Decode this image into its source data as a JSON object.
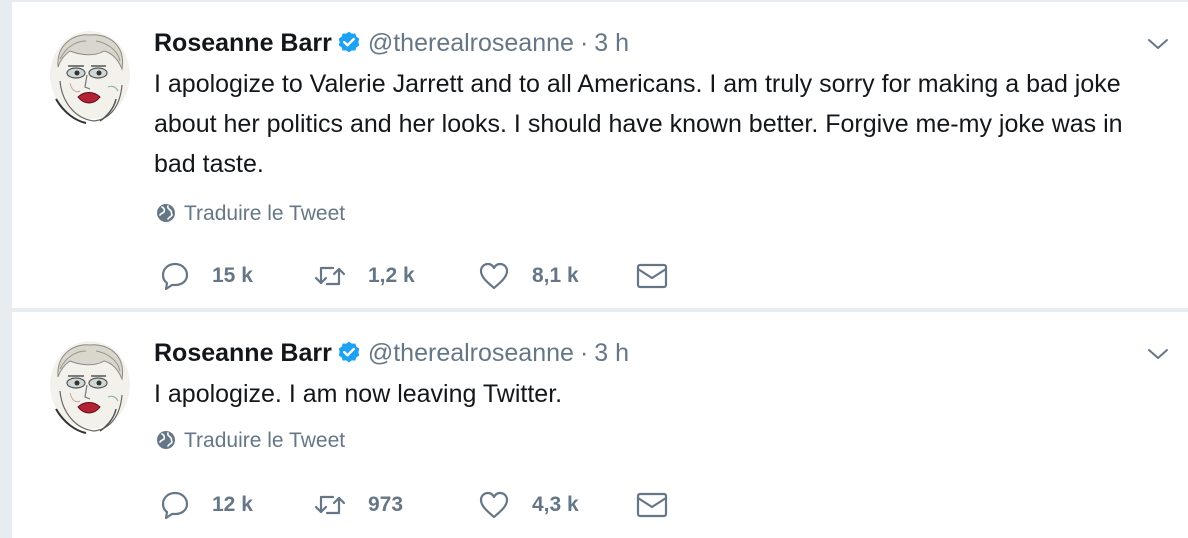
{
  "tweets": [
    {
      "author_name": "Roseanne Barr",
      "handle": "@therealroseanne",
      "separator": "·",
      "time": "3 h",
      "text": "I apologize to Valerie Jarrett and to all Americans. I am truly sorry for making a bad joke about her politics and her looks. I should have known better. Forgive me-my joke was in bad taste.",
      "translate_label": "Traduire le Tweet",
      "replies": "15 k",
      "retweets": "1,2 k",
      "likes": "8,1 k"
    },
    {
      "author_name": "Roseanne Barr",
      "handle": "@therealroseanne",
      "separator": "·",
      "time": "3 h",
      "text": "I apologize. I am now leaving Twitter.",
      "translate_label": "Traduire le Tweet",
      "replies": "12 k",
      "retweets": "973",
      "likes": "4,3 k"
    }
  ],
  "icons": {
    "avatar": "avatar",
    "verified": "verified-badge-icon",
    "chevron": "chevron-down-icon",
    "globe": "globe-icon",
    "reply": "reply-icon",
    "retweet": "retweet-icon",
    "like": "heart-icon",
    "dm": "envelope-icon"
  },
  "colors": {
    "background": "#e6ecf0",
    "text": "#14171a",
    "secondary": "#657786",
    "verified_blue": "#1da1f2"
  }
}
